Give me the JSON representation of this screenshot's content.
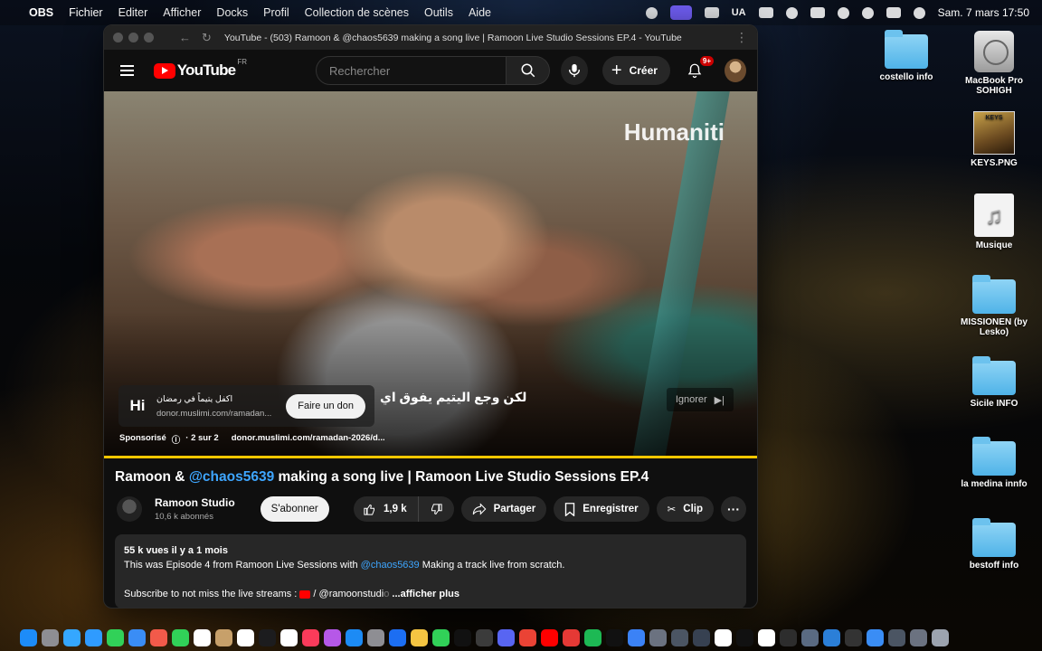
{
  "menubar": {
    "app_name": "OBS",
    "items": [
      "Fichier",
      "Editer",
      "Afficher",
      "Docks",
      "Profil",
      "Collection de scènes",
      "Outils",
      "Aide"
    ],
    "status_text": "UA",
    "clock": "Sam. 7 mars  17:50"
  },
  "window": {
    "title": "YouTube - (503) Ramoon & @chaos5639 making a song live | Ramoon Live Studio Sessions EP.4 - YouTube"
  },
  "youtube": {
    "logo_text": "YouTube",
    "region": "FR",
    "search_placeholder": "Rechercher",
    "create_label": "Créer",
    "notif_badge": "9+"
  },
  "ad": {
    "watermark": "Humaniti",
    "logo": "Hi",
    "headline": "اكفل يتيماً في رمضان",
    "url_short": "donor.muslimi.com/ramadan...",
    "cta": "Faire un don",
    "caption": "لكن وجع اليتيم يفوق اي",
    "skip_label": "Ignorer",
    "sponsored": "Sponsorisé",
    "count": "· 2 sur 2",
    "url_full": "donor.muslimi.com/ramadan-2026/d...",
    "progress_fraction": 1.0,
    "progress_color": "#f6c700"
  },
  "video": {
    "title_pre": "Ramoon & ",
    "title_mention": "@chaos5639",
    "title_post": " making a song live | Ramoon Live Studio Sessions EP.4",
    "channel": "Ramoon Studio",
    "subscribers": "10,6 k abonnés",
    "subscribe_label": "S'abonner",
    "likes": "1,9 k",
    "share_label": "Partager",
    "save_label": "Enregistrer",
    "clip_label": "Clip"
  },
  "description": {
    "stats": "55 k vues  il y a 1 mois",
    "line1_pre": "This was Episode 4 from Ramoon Live Sessions with ",
    "line1_mention": "@chaos5639",
    "line1_post": "  Making a track live from scratch.",
    "line2_pre": "Subscribe to not miss the live streams : ",
    "line2_handle": "/ @ramoonstudi",
    "line2_fade": "o",
    "more": " ...afficher plus"
  },
  "desktop": {
    "icons": [
      "costello info",
      "MacBook Pro SOHIGH",
      "KEYS.PNG",
      "Musique",
      "MISSIONEN (by Lesko)",
      "Sicile INFO",
      "la medina innfo",
      "bestoff info"
    ],
    "keys_thumb_text": "KEYS"
  },
  "dock": {
    "colors": [
      "#1d8cf8",
      "#8e8e93",
      "#35a7ff",
      "#2f9bff",
      "#31d158",
      "#3a8df5",
      "#f25a4a",
      "#31d158",
      "#ffffff",
      "#c7a06a",
      "#ffffff",
      "#1c1c1e",
      "#ffffff",
      "#fb3b5a",
      "#b658e8",
      "#1c8bf5",
      "#8e8e93",
      "#1c6ef2",
      "#f5c542",
      "#31d158",
      "#111111",
      "#3b3b3b",
      "#5865f2",
      "#ea4335",
      "#ff0000",
      "#e53935",
      "#1db954",
      "#111111",
      "#3b82f6",
      "#6b7280",
      "#4b5563",
      "#374151",
      "#ffffff",
      "#111111",
      "#ffffff",
      "#2d2d2d",
      "#5a6a82",
      "#2b7fd8",
      "#333333",
      "#3a8df5",
      "#4b5563",
      "#6b7280",
      "#9ca3af"
    ]
  }
}
